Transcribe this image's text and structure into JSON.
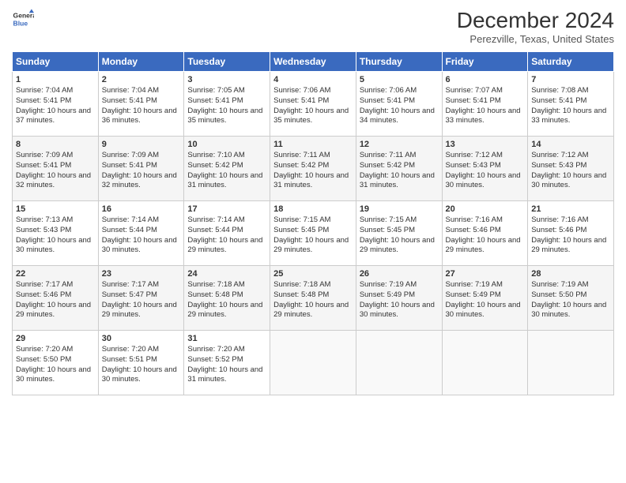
{
  "logo": {
    "line1": "General",
    "line2": "Blue"
  },
  "title": "December 2024",
  "subtitle": "Perezville, Texas, United States",
  "header": {
    "days": [
      "Sunday",
      "Monday",
      "Tuesday",
      "Wednesday",
      "Thursday",
      "Friday",
      "Saturday"
    ]
  },
  "weeks": [
    [
      {
        "day": "1",
        "sunrise": "7:04 AM",
        "sunset": "5:41 PM",
        "daylight": "10 hours and 37 minutes."
      },
      {
        "day": "2",
        "sunrise": "7:04 AM",
        "sunset": "5:41 PM",
        "daylight": "10 hours and 36 minutes."
      },
      {
        "day": "3",
        "sunrise": "7:05 AM",
        "sunset": "5:41 PM",
        "daylight": "10 hours and 35 minutes."
      },
      {
        "day": "4",
        "sunrise": "7:06 AM",
        "sunset": "5:41 PM",
        "daylight": "10 hours and 35 minutes."
      },
      {
        "day": "5",
        "sunrise": "7:06 AM",
        "sunset": "5:41 PM",
        "daylight": "10 hours and 34 minutes."
      },
      {
        "day": "6",
        "sunrise": "7:07 AM",
        "sunset": "5:41 PM",
        "daylight": "10 hours and 33 minutes."
      },
      {
        "day": "7",
        "sunrise": "7:08 AM",
        "sunset": "5:41 PM",
        "daylight": "10 hours and 33 minutes."
      }
    ],
    [
      {
        "day": "8",
        "sunrise": "7:09 AM",
        "sunset": "5:41 PM",
        "daylight": "10 hours and 32 minutes."
      },
      {
        "day": "9",
        "sunrise": "7:09 AM",
        "sunset": "5:41 PM",
        "daylight": "10 hours and 32 minutes."
      },
      {
        "day": "10",
        "sunrise": "7:10 AM",
        "sunset": "5:42 PM",
        "daylight": "10 hours and 31 minutes."
      },
      {
        "day": "11",
        "sunrise": "7:11 AM",
        "sunset": "5:42 PM",
        "daylight": "10 hours and 31 minutes."
      },
      {
        "day": "12",
        "sunrise": "7:11 AM",
        "sunset": "5:42 PM",
        "daylight": "10 hours and 31 minutes."
      },
      {
        "day": "13",
        "sunrise": "7:12 AM",
        "sunset": "5:43 PM",
        "daylight": "10 hours and 30 minutes."
      },
      {
        "day": "14",
        "sunrise": "7:12 AM",
        "sunset": "5:43 PM",
        "daylight": "10 hours and 30 minutes."
      }
    ],
    [
      {
        "day": "15",
        "sunrise": "7:13 AM",
        "sunset": "5:43 PM",
        "daylight": "10 hours and 30 minutes."
      },
      {
        "day": "16",
        "sunrise": "7:14 AM",
        "sunset": "5:44 PM",
        "daylight": "10 hours and 30 minutes."
      },
      {
        "day": "17",
        "sunrise": "7:14 AM",
        "sunset": "5:44 PM",
        "daylight": "10 hours and 29 minutes."
      },
      {
        "day": "18",
        "sunrise": "7:15 AM",
        "sunset": "5:45 PM",
        "daylight": "10 hours and 29 minutes."
      },
      {
        "day": "19",
        "sunrise": "7:15 AM",
        "sunset": "5:45 PM",
        "daylight": "10 hours and 29 minutes."
      },
      {
        "day": "20",
        "sunrise": "7:16 AM",
        "sunset": "5:46 PM",
        "daylight": "10 hours and 29 minutes."
      },
      {
        "day": "21",
        "sunrise": "7:16 AM",
        "sunset": "5:46 PM",
        "daylight": "10 hours and 29 minutes."
      }
    ],
    [
      {
        "day": "22",
        "sunrise": "7:17 AM",
        "sunset": "5:46 PM",
        "daylight": "10 hours and 29 minutes."
      },
      {
        "day": "23",
        "sunrise": "7:17 AM",
        "sunset": "5:47 PM",
        "daylight": "10 hours and 29 minutes."
      },
      {
        "day": "24",
        "sunrise": "7:18 AM",
        "sunset": "5:48 PM",
        "daylight": "10 hours and 29 minutes."
      },
      {
        "day": "25",
        "sunrise": "7:18 AM",
        "sunset": "5:48 PM",
        "daylight": "10 hours and 29 minutes."
      },
      {
        "day": "26",
        "sunrise": "7:19 AM",
        "sunset": "5:49 PM",
        "daylight": "10 hours and 30 minutes."
      },
      {
        "day": "27",
        "sunrise": "7:19 AM",
        "sunset": "5:49 PM",
        "daylight": "10 hours and 30 minutes."
      },
      {
        "day": "28",
        "sunrise": "7:19 AM",
        "sunset": "5:50 PM",
        "daylight": "10 hours and 30 minutes."
      }
    ],
    [
      {
        "day": "29",
        "sunrise": "7:20 AM",
        "sunset": "5:50 PM",
        "daylight": "10 hours and 30 minutes."
      },
      {
        "day": "30",
        "sunrise": "7:20 AM",
        "sunset": "5:51 PM",
        "daylight": "10 hours and 30 minutes."
      },
      {
        "day": "31",
        "sunrise": "7:20 AM",
        "sunset": "5:52 PM",
        "daylight": "10 hours and 31 minutes."
      },
      null,
      null,
      null,
      null
    ]
  ]
}
